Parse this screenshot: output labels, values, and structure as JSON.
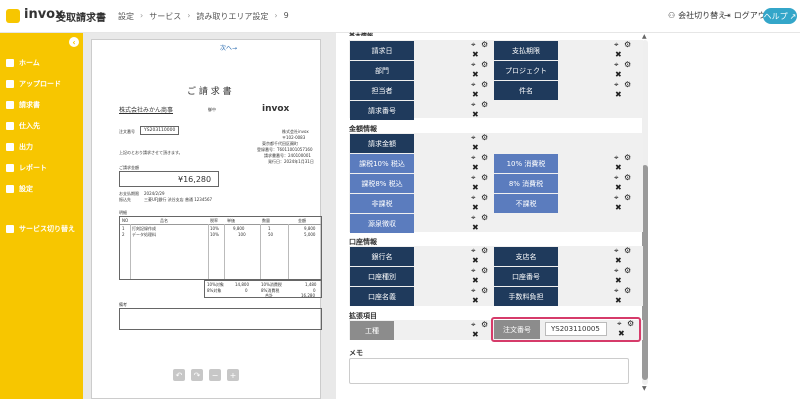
{
  "header": {
    "logo_text": "invox",
    "logo_sub": "受取請求書",
    "breadcrumb": [
      "設定",
      "サービス",
      "読み取りエリア設定",
      "9"
    ],
    "company_switch": "会社切り替え",
    "logout": "ログアウト",
    "help": "ヘルプ"
  },
  "sidebar": {
    "items": [
      {
        "label": "ホーム"
      },
      {
        "label": "アップロード"
      },
      {
        "label": "請求書"
      },
      {
        "label": "仕入先"
      },
      {
        "label": "出力"
      },
      {
        "label": "レポート"
      },
      {
        "label": "設定"
      },
      {
        "label": "サービス切り替え"
      }
    ]
  },
  "document": {
    "next_page": "次へ→",
    "title": "ご 請 求 書",
    "recipient": "株式会社みかん商事",
    "recipient_suffix": "御中",
    "order_label": "注文番号",
    "order_number": "YS203110000",
    "intro": "上記のとおり請求させて頂きます。",
    "total_label": "ご請求金額",
    "total": "¥16,280",
    "brand": "invox",
    "issuer_lines": [
      "株式会社invox",
      "〒102-0083",
      "東京都千代田区麹町",
      "登録番号：T6011001057160",
      "請求書番号：240100001",
      "発行日：2024年1月31日"
    ],
    "due_label": "お支払期限",
    "due_date": "2024/2/29",
    "bank_label": "振込先",
    "bank_text": "三菱UFJ銀行 渋谷支店 普通 1234567",
    "notes_label": "明細",
    "table_headers": [
      "NO",
      "品名",
      "税率",
      "単価",
      "数量",
      "金額"
    ],
    "rows": [
      [
        "1",
        "打刻記録作成",
        "10%",
        "9,800",
        "1",
        "9,800"
      ],
      [
        "2",
        "データ処理料",
        "10%",
        "100",
        "50",
        "5,000"
      ]
    ],
    "summary": [
      [
        "10%対象",
        "14,800",
        "10%消費税",
        "1,480"
      ],
      [
        "8%対象",
        "0",
        "8%消費税",
        "0"
      ],
      [
        "",
        "",
        "合計",
        "16,280"
      ]
    ],
    "remarks_label": "備考"
  },
  "form": {
    "top_cut": "基本情報",
    "basic": [
      {
        "left": "請求日",
        "right": "支払期限"
      },
      {
        "left": "部門",
        "right": "プロジェクト"
      },
      {
        "left": "担当者",
        "right": "件名"
      },
      {
        "left": "請求番号",
        "right": ""
      }
    ],
    "amount_title": "金額情報",
    "amount": [
      {
        "left": "請求金額",
        "right": ""
      },
      {
        "left": "課税10% 税込",
        "right": "10% 消費税"
      },
      {
        "left": "課税8% 税込",
        "right": "8% 消費税"
      },
      {
        "left": "非課税",
        "right": "不課税"
      },
      {
        "left": "源泉徴収",
        "right": ""
      }
    ],
    "bank_title": "口座情報",
    "bank": [
      {
        "left": "銀行名",
        "right": "支店名"
      },
      {
        "left": "口座種別",
        "right": "口座番号"
      },
      {
        "left": "口座名義",
        "right": "手数料負担"
      }
    ],
    "ext_title": "拡張項目",
    "ext_left": "工種",
    "ext_right": "注文番号",
    "ext_value": "YS203110005",
    "memo_title": "メモ"
  },
  "icons": {
    "move": "move-icon",
    "gear": "gear-icon",
    "close": "close-icon"
  },
  "colors": {
    "brand_yellow": "#f7c600",
    "dark_cell": "#1f3a5c",
    "light_cell": "#5b7cbe",
    "highlight": "#d63b6a",
    "help": "#34a6c9"
  }
}
